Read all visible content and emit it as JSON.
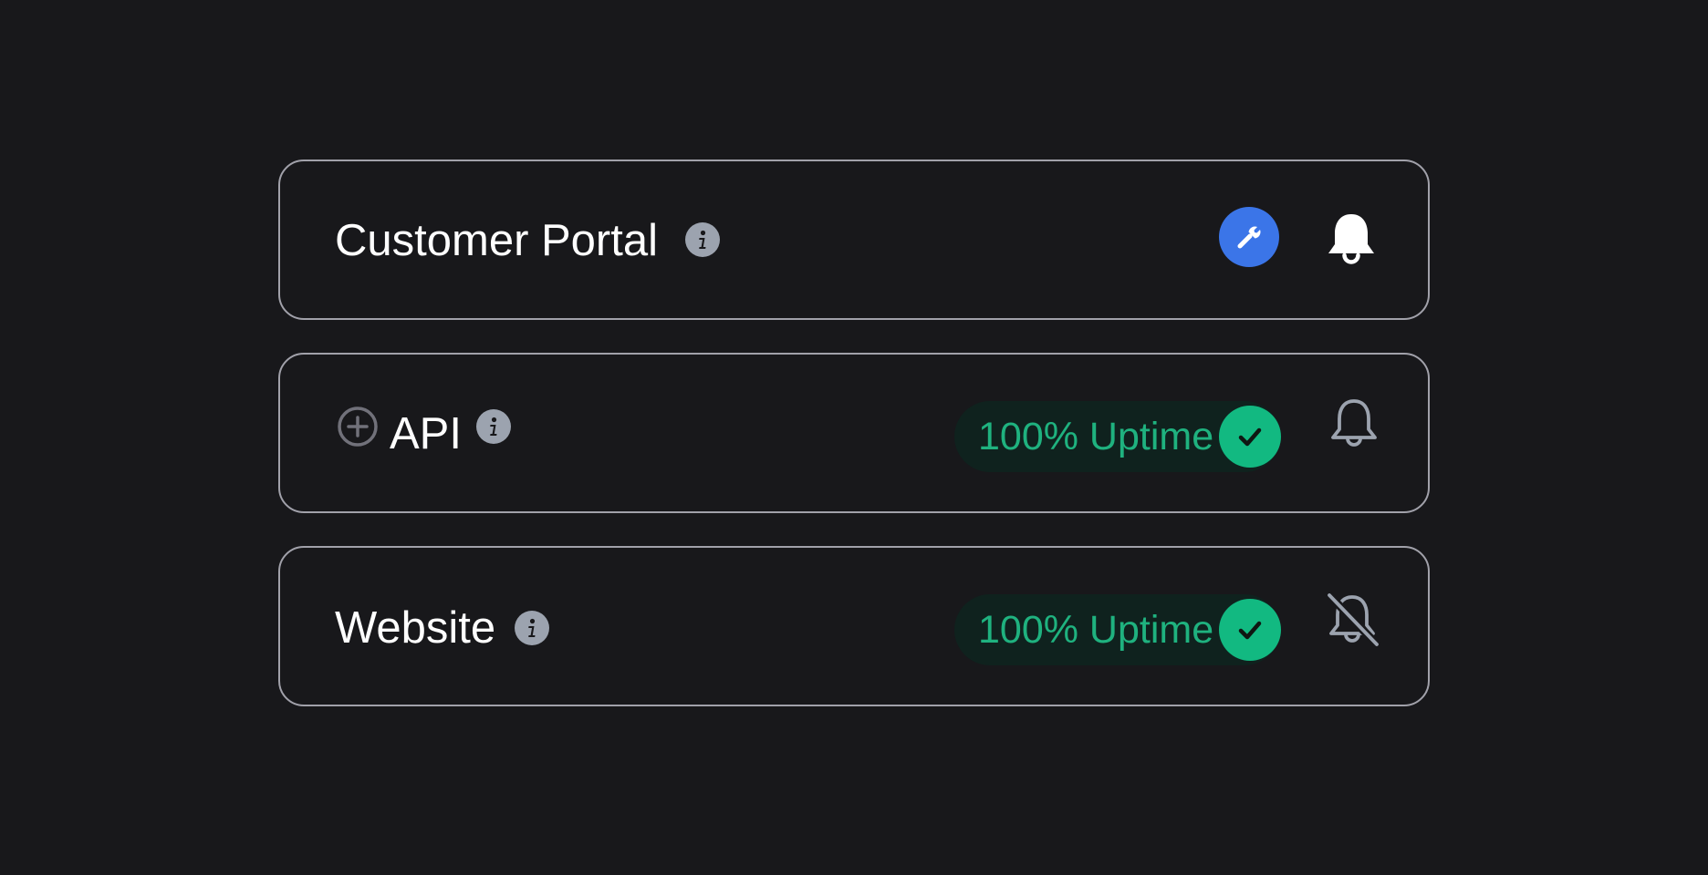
{
  "monitors": [
    {
      "name": "Customer Portal",
      "info_icon": "info-icon",
      "status_icon": "wrench-icon",
      "status_color": "#3b75e8",
      "alert_icon": "bell-filled-icon",
      "alert_color": "#ffffff"
    },
    {
      "name": "API",
      "expand_icon": "plus-circle-icon",
      "info_icon": "info-icon",
      "uptime_label": "100% Uptime",
      "status_icon": "check-icon",
      "status_color": "#12b981",
      "alert_icon": "bell-outline-icon",
      "alert_color": "#9ca3af"
    },
    {
      "name": "Website",
      "info_icon": "info-icon",
      "uptime_label": "100% Uptime",
      "status_icon": "check-icon",
      "status_color": "#12b981",
      "alert_icon": "bell-off-icon",
      "alert_color": "#9ca3af"
    }
  ]
}
